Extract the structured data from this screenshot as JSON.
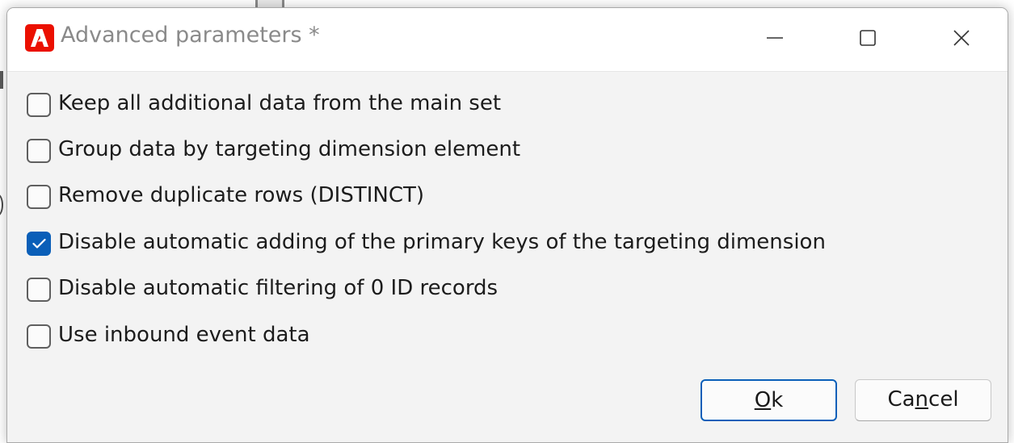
{
  "window": {
    "title": "Advanced parameters *",
    "app_icon": "adobe-icon",
    "controls": [
      "minimize-icon",
      "maximize-icon",
      "close-icon"
    ]
  },
  "options": [
    {
      "label": "Keep all additional data from the main set",
      "checked": false
    },
    {
      "label": "Group data by targeting dimension element",
      "checked": false
    },
    {
      "label": "Remove duplicate rows (DISTINCT)",
      "checked": false
    },
    {
      "label": "Disable automatic adding of the primary keys of the targeting dimension",
      "checked": true
    },
    {
      "label": "Disable automatic filtering of 0 ID records",
      "checked": false
    },
    {
      "label": "Use inbound event data",
      "checked": false
    }
  ],
  "buttons": {
    "ok": {
      "mnemonic": "O",
      "rest": "k"
    },
    "cancel": {
      "before": "Ca",
      "mnemonic": "n",
      "after": "cel"
    }
  },
  "colors": {
    "accent": "#0a5fb8",
    "app_icon": "#eb1000",
    "title_text": "#8a8a8a"
  }
}
